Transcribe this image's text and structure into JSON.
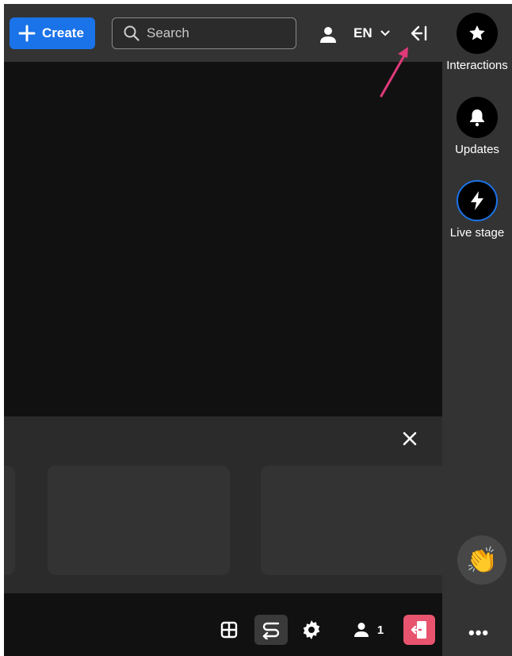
{
  "header": {
    "create_label": "Create",
    "search_placeholder": "Search",
    "language": "EN"
  },
  "side_panel": {
    "items": [
      {
        "label": "Interactions",
        "icon": "star-icon"
      },
      {
        "label": "Updates",
        "icon": "bell-icon"
      },
      {
        "label": "Live stage",
        "icon": "lightning-icon"
      }
    ],
    "reaction_icon": "👏",
    "more_label": "•••"
  },
  "bottom_bar": {
    "participant_count": "1"
  },
  "colors": {
    "accent": "#1a73e8",
    "leave": "#e8546e",
    "annotation_arrow": "#e03a7a"
  }
}
